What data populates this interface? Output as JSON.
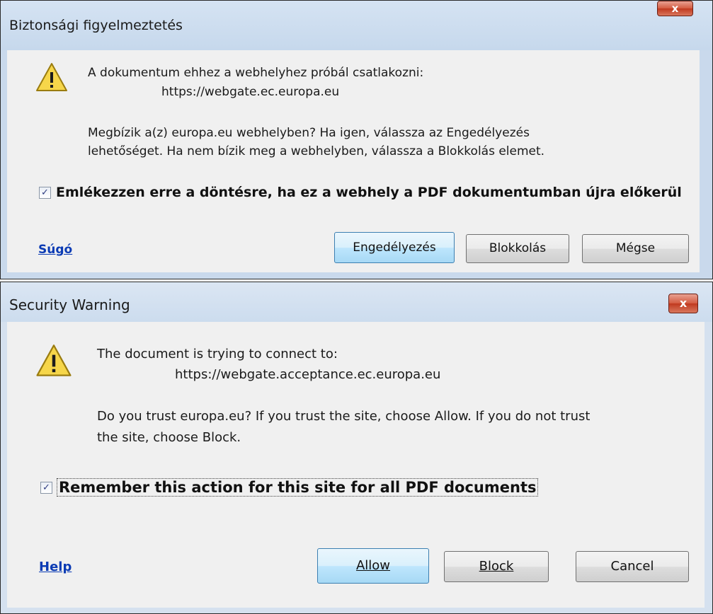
{
  "dialog_hu": {
    "title": "Biztonsági figyelmeztetés",
    "close_label": "x",
    "message_line1": "A dokumentum ehhez a webhelyhez próbál csatlakozni:",
    "url": "https://webgate.ec.europa.eu",
    "question_line1": "Megbízik a(z) europa.eu webhelyben? Ha igen, válassza az Engedélyezés",
    "question_line2": "lehetőséget. Ha nem bízik meg a webhelyben, válassza a Blokkolás elemet.",
    "remember_label": "Emlékezzen erre a döntésre, ha ez a webhely a PDF dokumentumban újra előkerül",
    "remember_checked": true,
    "help_label": "Súgó",
    "allow_label": "Engedélyezés",
    "block_label": "Blokkolás",
    "cancel_label": "Mégse"
  },
  "dialog_en": {
    "title": "Security Warning",
    "close_label": "x",
    "message_line1": "The document is trying to connect to:",
    "url": "https://webgate.acceptance.ec.europa.eu",
    "question_line1": "Do you trust europa.eu? If you trust the site, choose Allow. If you do not trust",
    "question_line2": "the site, choose Block.",
    "remember_label": "Remember this action for this site for all PDF documents",
    "remember_checked": true,
    "help_label": "Help",
    "allow_label": "Allow",
    "block_label": "Block",
    "cancel_label": "Cancel"
  },
  "icons": {
    "warning": "warning-triangle-icon",
    "checkmark": "✓"
  },
  "colors": {
    "frame": "#c9d9ec",
    "client": "#f0f0f0",
    "close": "#c0391f",
    "link": "#0b3bb4",
    "warning_fill": "#f6d64a"
  }
}
